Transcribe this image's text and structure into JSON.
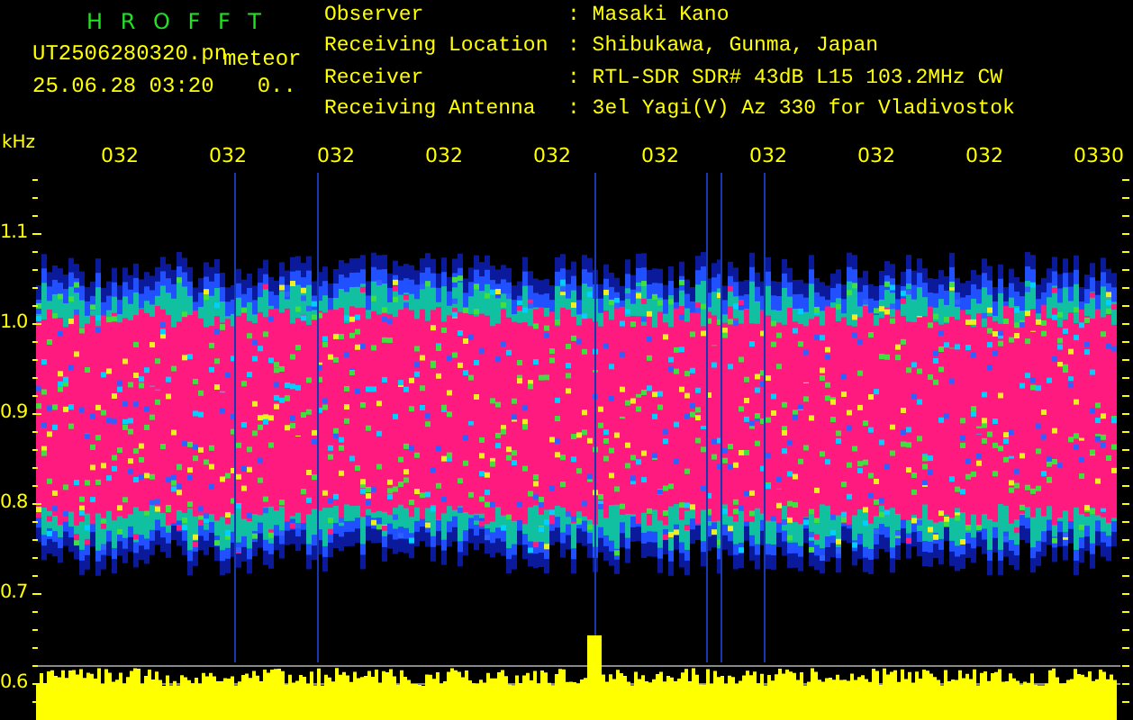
{
  "app_title": "H R O F F T",
  "file": {
    "name": "UT2506280320.pn",
    "tag": "meteor",
    "date": "25.06.28 03:20",
    "count": "0.."
  },
  "info": [
    {
      "label": "Observer",
      "value": ": Masaki Kano"
    },
    {
      "label": "Receiving Location",
      "value": ": Shibukawa, Gunma, Japan"
    },
    {
      "label": "Receiver",
      "value": ": RTL-SDR SDR# 43dB L15 103.2MHz CW"
    },
    {
      "label": "Receiving Antenna",
      "value": ": 3el Yagi(V) Az 330 for Vladivostok"
    }
  ],
  "y_unit": "kHz",
  "y_labels": [
    "1.1",
    "1.0",
    "0.9",
    "0.8",
    "0.7",
    "0.6"
  ],
  "x_labels": [
    "032",
    "032",
    "032",
    "032",
    "032",
    "032",
    "032",
    "032",
    "032",
    "0330"
  ]
}
